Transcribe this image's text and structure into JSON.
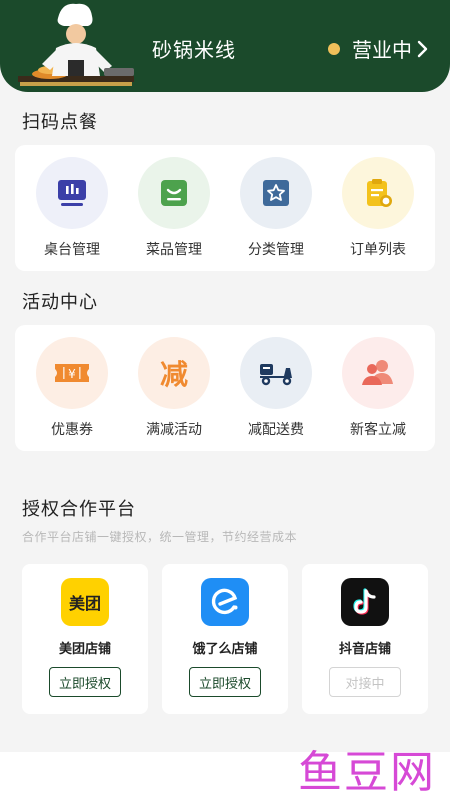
{
  "header": {
    "shop_name": "砂锅米线",
    "status": "营业中"
  },
  "sections": {
    "scan_order": {
      "title": "扫码点餐",
      "items": [
        {
          "label": "桌台管理",
          "icon": "table-icon"
        },
        {
          "label": "菜品管理",
          "icon": "dish-icon"
        },
        {
          "label": "分类管理",
          "icon": "category-star-icon"
        },
        {
          "label": "订单列表",
          "icon": "order-list-icon"
        }
      ]
    },
    "activity": {
      "title": "活动中心",
      "items": [
        {
          "label": "优惠券",
          "icon": "coupon-icon"
        },
        {
          "label": "满减活动",
          "icon": "full-reduction-icon",
          "glyph": "减"
        },
        {
          "label": "减配送费",
          "icon": "delivery-scooter-icon"
        },
        {
          "label": "新客立减",
          "icon": "new-customer-icon"
        }
      ]
    },
    "auth": {
      "title": "授权合作平台",
      "subtitle": "合作平台店铺一键授权，统一管理，节约经营成本",
      "platforms": [
        {
          "name": "美团店铺",
          "logo_text": "美团",
          "button": "立即授权",
          "enabled": true
        },
        {
          "name": "饿了么店铺",
          "logo_text": "e",
          "button": "立即授权",
          "enabled": true
        },
        {
          "name": "抖音店铺",
          "logo_text": "♪",
          "button": "对接中",
          "enabled": false
        }
      ]
    }
  },
  "watermark": "鱼豆网",
  "colors": {
    "brand_green": "#1b4a2b",
    "status_dot": "#f0c05a",
    "activity_orange": "#f08a30",
    "meituan_yellow": "#ffd100",
    "eleme_blue": "#1f8ef5",
    "watermark": "#d02acf"
  }
}
